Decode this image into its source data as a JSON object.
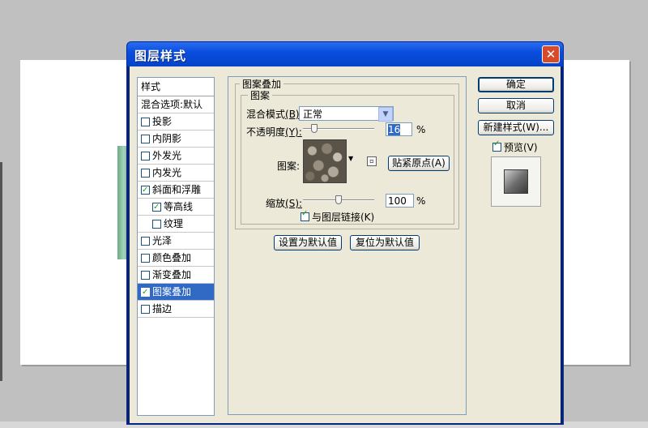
{
  "dialog": {
    "title": "图层样式",
    "close_glyph": "✕"
  },
  "style_list": {
    "header": "样式",
    "blend_options": "混合选项:默认",
    "items": [
      {
        "label": "投影",
        "checked": false,
        "indent": false,
        "selected": false
      },
      {
        "label": "内阴影",
        "checked": false,
        "indent": false,
        "selected": false
      },
      {
        "label": "外发光",
        "checked": false,
        "indent": false,
        "selected": false
      },
      {
        "label": "内发光",
        "checked": false,
        "indent": false,
        "selected": false
      },
      {
        "label": "斜面和浮雕",
        "checked": true,
        "indent": false,
        "selected": false
      },
      {
        "label": "等高线",
        "checked": true,
        "indent": true,
        "selected": false
      },
      {
        "label": "纹理",
        "checked": false,
        "indent": true,
        "selected": false
      },
      {
        "label": "光泽",
        "checked": false,
        "indent": false,
        "selected": false
      },
      {
        "label": "颜色叠加",
        "checked": false,
        "indent": false,
        "selected": false
      },
      {
        "label": "渐变叠加",
        "checked": false,
        "indent": false,
        "selected": false
      },
      {
        "label": "图案叠加",
        "checked": true,
        "indent": false,
        "selected": true
      },
      {
        "label": "描边",
        "checked": false,
        "indent": false,
        "selected": false
      }
    ]
  },
  "pattern_overlay": {
    "section_title": "图案叠加",
    "group_title": "图案",
    "blend_mode_label": "混合模式",
    "blend_mode_key": "(B):",
    "blend_mode_value": "正常",
    "opacity_label": "不透明度",
    "opacity_key": "(Y):",
    "opacity_value": "16",
    "opacity_level": 0.16,
    "percent": "%",
    "pattern_label": "图案:",
    "snap_origin_button": "贴紧原点(A)",
    "scale_label": "缩放",
    "scale_key": "(S):",
    "scale_value": "100",
    "scale_level": 0.5,
    "link_layer_label": "与图层链接(K)",
    "link_layer_checked": true,
    "set_default_button": "设置为默认值",
    "reset_default_button": "复位为默认值",
    "pattern_icon": "stones-pattern-swatch",
    "new_preset_icon": "new-preset-icon"
  },
  "buttons": {
    "ok": "确定",
    "cancel": "取消",
    "new_style": "新建样式(W)...",
    "preview_label": "预览(V)",
    "preview_checked": true
  },
  "colors": {
    "titlebar": "#0a4ee0",
    "selection": "#316ac5",
    "dialog_bg": "#ece9d8",
    "close_button": "#d84a2a"
  }
}
